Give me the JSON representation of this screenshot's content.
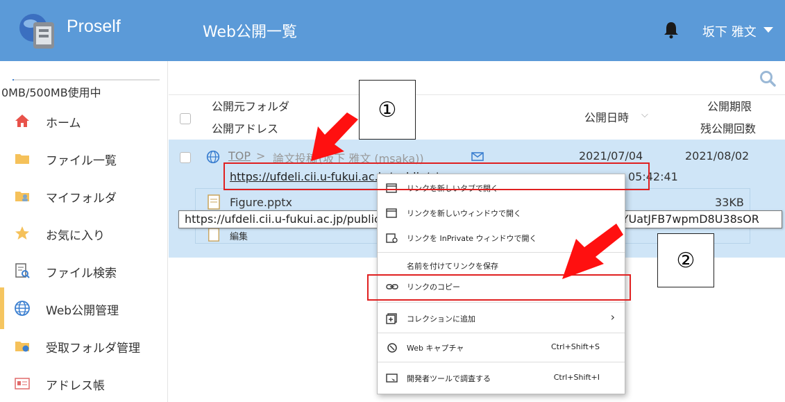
{
  "header": {
    "app_name": "Proself",
    "page_title": "Web公開一覧",
    "user_name": "坂下 雅文"
  },
  "sidebar": {
    "usage": "0MB/500MB使用中",
    "items": [
      {
        "label": "ホーム",
        "icon": "home-icon"
      },
      {
        "label": "ファイル一覧",
        "icon": "folder-icon"
      },
      {
        "label": "マイフォルダ",
        "icon": "my-folder-icon"
      },
      {
        "label": "お気に入り",
        "icon": "star-icon"
      },
      {
        "label": "ファイル検索",
        "icon": "file-search-icon"
      },
      {
        "label": "Web公開管理",
        "icon": "globe-icon",
        "active": true
      },
      {
        "label": "受取フォルダ管理",
        "icon": "receive-folder-icon"
      },
      {
        "label": "アドレス帳",
        "icon": "address-book-icon"
      }
    ]
  },
  "table": {
    "col_source_folder": "公開元フォルダ",
    "col_public_address": "公開アドレス",
    "col_public_date": "公開日時",
    "col_expiry": "公開期限",
    "col_remaining": "残公開回数",
    "sort_indicator": "⌵",
    "row": {
      "folder_top": "TOP",
      "folder_sep": ">",
      "folder_name": "論文投稿",
      "owner": "(坂下 雅文 (msaka))",
      "url": "https://ufdeli.cii.u-fukui.ac.jp/public/e7sAcAlUD_8",
      "date": "2021/07/04",
      "time": "05:42:41",
      "expiry": "2021/08/02",
      "file_name": "Figure.pptx",
      "file_size": "33KB",
      "file_sub": "編集"
    }
  },
  "tooltip": {
    "text": "https://ufdeli.cii.u-fukui.ac.jp/public/e7sAcAlUD_8EMAIdWvQy2cFDW5IUsK2UrTYUatJFB7wpmD8U38sOR"
  },
  "context_menu": {
    "items": [
      {
        "label": "リンクを新しいタブで開く",
        "shortcut": ""
      },
      {
        "label": "リンクを新しいウィンドウで開く",
        "shortcut": ""
      },
      {
        "label": "リンクを InPrivate ウィンドウで開く",
        "shortcut": ""
      },
      {
        "label": "名前を付けてリンクを保存",
        "shortcut": ""
      },
      {
        "label": "リンクのコピー",
        "shortcut": ""
      },
      {
        "label": "コレクションに追加",
        "shortcut": "",
        "arrow": "›"
      },
      {
        "label": "Web キャプチャ",
        "shortcut": "Ctrl+Shift+S"
      },
      {
        "label": "開発者ツールで調査する",
        "shortcut": "Ctrl+Shift+I"
      }
    ]
  },
  "annotations": {
    "callout_1": "①",
    "callout_2": "②",
    "highlight_color": "#e02020"
  },
  "colors": {
    "header_bg": "#5b9ad8",
    "selected_row": "#cfe5f7",
    "active_marker": "#f5c560"
  }
}
